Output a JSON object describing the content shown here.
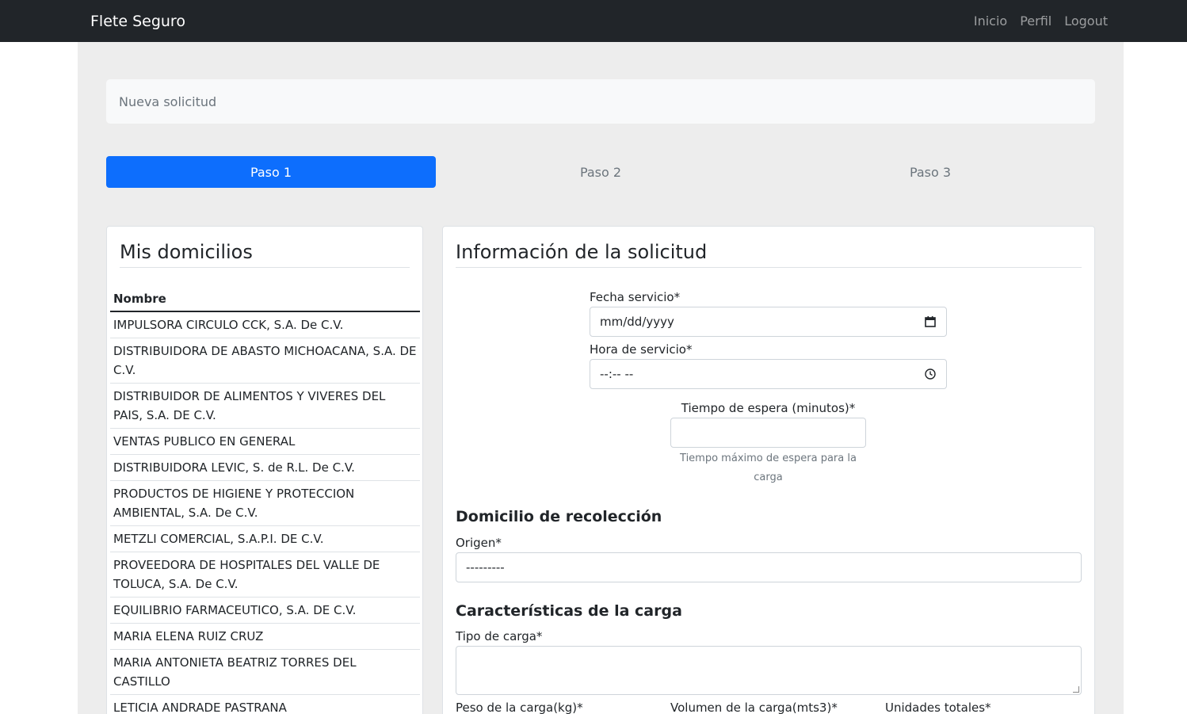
{
  "navbar": {
    "brand": "Flete Seguro",
    "links": [
      "Inicio",
      "Perfil",
      "Logout"
    ]
  },
  "breadcrumb": {
    "text": "Nueva solicitud"
  },
  "steps": [
    "Paso 1",
    "Paso 2",
    "Paso 3"
  ],
  "active_step": 0,
  "domicilios": {
    "title": "Mis domicilios",
    "column_header": "Nombre",
    "rows": [
      "IMPULSORA CIRCULO CCK, S.A. De C.V.",
      "DISTRIBUIDORA DE ABASTO MICHOACANA, S.A. DE C.V.",
      "DISTRIBUIDOR DE ALIMENTOS Y VIVERES DEL PAIS, S.A. DE C.V.",
      "VENTAS PUBLICO EN GENERAL",
      "DISTRIBUIDORA LEVIC, S. de R.L. De C.V.",
      "PRODUCTOS DE HIGIENE Y PROTECCION AMBIENTAL, S.A. De C.V.",
      "METZLI COMERCIAL, S.A.P.I. DE C.V.",
      "PROVEEDORA DE HOSPITALES DEL VALLE DE TOLUCA, S.A. De C.V.",
      "EQUILIBRIO FARMACEUTICO, S.A. DE C.V.",
      "MARIA ELENA RUIZ CRUZ",
      "MARIA ANTONIETA BEATRIZ TORRES DEL CASTILLO",
      "LETICIA ANDRADE PASTRANA"
    ]
  },
  "form": {
    "title": "Información de la solicitud",
    "fecha_label": "Fecha servicio*",
    "fecha_value": "mm/dd/yyyy",
    "hora_label": "Hora de servicio*",
    "hora_value": "--:-- --",
    "espera_label": "Tiempo de espera (minutos)*",
    "espera_help": "Tiempo máximo de espera para la carga",
    "recoleccion_heading": "Domicilio de recolección",
    "origen_label": "Origen*",
    "origen_value": "---------",
    "carga_heading": "Características de la carga",
    "tipo_label": "Tipo de carga*",
    "peso_label": "Peso de la carga(kg)*",
    "volumen_label": "Volumen de la carga(mts3)*",
    "unidades_label": "Unidades totales*"
  },
  "colors": {
    "navbar_bg": "#212529",
    "primary": "#0d6efd",
    "container_bg": "#ededed"
  },
  "icons": [
    "calendar-icon",
    "clock-icon"
  ]
}
